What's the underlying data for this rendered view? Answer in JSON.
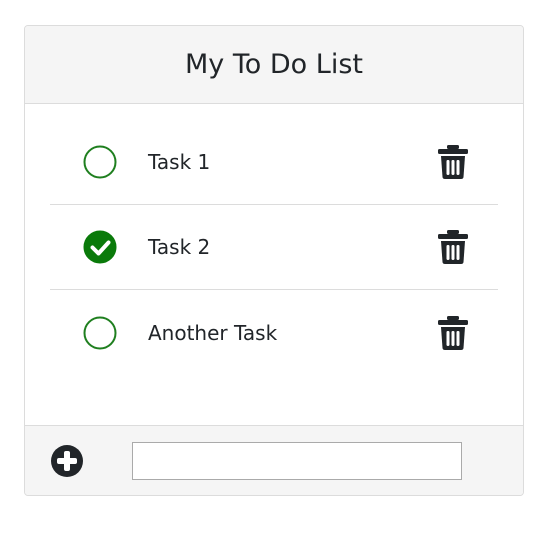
{
  "header": {
    "title": "My To Do List"
  },
  "tasks": [
    {
      "label": "Task 1",
      "done": false
    },
    {
      "label": "Task 2",
      "done": true
    },
    {
      "label": "Another Task",
      "done": false
    }
  ],
  "footer": {
    "input_value": "",
    "input_placeholder": ""
  },
  "icons": {
    "unchecked": "circle-outline-icon",
    "checked": "check-circle-icon",
    "delete": "trash-icon",
    "add": "plus-circle-icon"
  },
  "colors": {
    "check_green": "#0a7a0a",
    "header_bg": "#f5f5f5",
    "icon_dark": "#212529"
  }
}
